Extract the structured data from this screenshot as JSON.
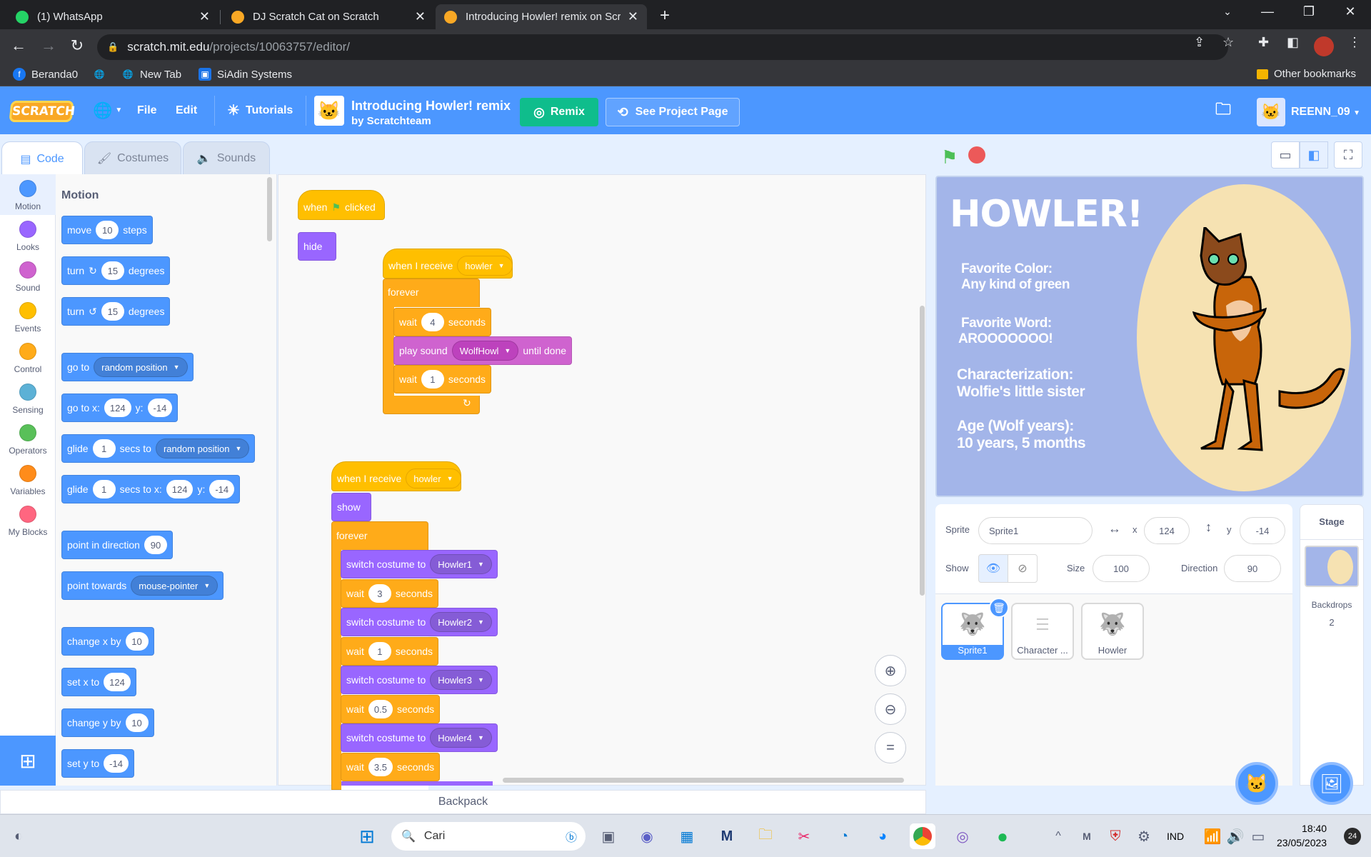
{
  "browser": {
    "tabs": [
      {
        "title": "(1) WhatsApp",
        "favicon_color": "#25d366",
        "active": false
      },
      {
        "title": "DJ Scratch Cat on Scratch",
        "favicon_color": "#f9a825",
        "active": false
      },
      {
        "title": "Introducing Howler! remix on Scr",
        "favicon_color": "#f9a825",
        "active": true
      }
    ],
    "url_host": "scratch.mit.edu",
    "url_path": "/projects/10063757/editor/",
    "bookmarks": [
      "Beranda0",
      "New Tab",
      "SiAdin Systems"
    ],
    "other_bookmarks": "Other bookmarks"
  },
  "menubar": {
    "logo": "SCRATCH",
    "file": "File",
    "edit": "Edit",
    "tutorials": "Tutorials",
    "project_title": "Introducing Howler! remix",
    "project_author": "by Scratchteam",
    "remix": "Remix",
    "see_project_page": "See Project Page",
    "username": "REENN_09"
  },
  "editor_tabs": [
    "Code",
    "Costumes",
    "Sounds"
  ],
  "categories": [
    {
      "label": "Motion",
      "color": "#4c97ff"
    },
    {
      "label": "Looks",
      "color": "#9966ff"
    },
    {
      "label": "Sound",
      "color": "#cf63cf"
    },
    {
      "label": "Events",
      "color": "#ffbf00"
    },
    {
      "label": "Control",
      "color": "#ffab19"
    },
    {
      "label": "Sensing",
      "color": "#5cb1d6"
    },
    {
      "label": "Operators",
      "color": "#59c059"
    },
    {
      "label": "Variables",
      "color": "#ff8c1a"
    },
    {
      "label": "My Blocks",
      "color": "#ff6680"
    }
  ],
  "palette": {
    "title": "Motion",
    "move": {
      "pre": "move",
      "val": "10",
      "post": "steps"
    },
    "turn_right": {
      "pre": "turn",
      "val": "15",
      "post": "degrees"
    },
    "turn_left": {
      "pre": "turn",
      "val": "15",
      "post": "degrees"
    },
    "goto": {
      "pre": "go to",
      "dd": "random position"
    },
    "gotoxy": {
      "pre": "go to x:",
      "x": "124",
      "ylbl": "y:",
      "y": "-14"
    },
    "glide_to": {
      "pre": "glide",
      "val": "1",
      "mid": "secs to",
      "dd": "random position"
    },
    "glide_xy": {
      "pre": "glide",
      "val": "1",
      "mid": "secs to x:",
      "x": "124",
      "ylbl": "y:",
      "y": "-14"
    },
    "point_dir": {
      "pre": "point in direction",
      "val": "90"
    },
    "point_towards": {
      "pre": "point towards",
      "dd": "mouse-pointer"
    },
    "change_x": {
      "pre": "change x by",
      "val": "10"
    },
    "set_x": {
      "pre": "set x to",
      "val": "124"
    },
    "change_y": {
      "pre": "change y by",
      "val": "10"
    },
    "set_y": {
      "pre": "set y to",
      "val": "-14"
    }
  },
  "scripts": {
    "s1": {
      "when": "when",
      "clicked": "clicked",
      "hide": "hide"
    },
    "s2": {
      "hat": "when I receive",
      "hat_dd": "howler",
      "forever": "forever",
      "wait1_pre": "wait",
      "wait1_val": "4",
      "wait1_post": "seconds",
      "play_pre": "play sound",
      "play_dd": "WolfHowl",
      "play_post": "until done",
      "wait2_pre": "wait",
      "wait2_val": "1",
      "wait2_post": "seconds"
    },
    "s3": {
      "hat": "when I receive",
      "hat_dd": "howler",
      "show": "show",
      "forever": "forever",
      "sc1": "switch costume to",
      "sc1_dd": "Howler1",
      "w1": "wait",
      "w1_val": "3",
      "w1_post": "seconds",
      "sc2": "switch costume to",
      "sc2_dd": "Howler2",
      "w2": "wait",
      "w2_val": "1",
      "w2_post": "seconds",
      "sc3": "switch costume to",
      "sc3_dd": "Howler3",
      "w3": "wait",
      "w3_val": "0.5",
      "w3_post": "seconds",
      "sc4": "switch costume to",
      "sc4_dd": "Howler4",
      "w4": "wait",
      "w4_val": "3.5",
      "w4_post": "seconds"
    }
  },
  "backpack": "Backpack",
  "stage": {
    "title": "HOWLER!",
    "lines": [
      "Favorite Color:",
      "Any kind of green",
      "Favorite Word:",
      "AROOOOOOO!",
      "Characterization:",
      "Wolfie's little sister",
      "Age (Wolf years):",
      "10 years, 5 months"
    ]
  },
  "sprite_info": {
    "sprite_label": "Sprite",
    "sprite_name": "Sprite1",
    "x_label": "x",
    "x": "124",
    "y_label": "y",
    "y": "-14",
    "show_label": "Show",
    "size_label": "Size",
    "size": "100",
    "direction_label": "Direction",
    "direction": "90"
  },
  "sprites": [
    "Sprite1",
    "Character ...",
    "Howler"
  ],
  "stage_pane": {
    "title": "Stage",
    "backdrops_label": "Backdrops",
    "backdrops_count": "2"
  },
  "taskbar": {
    "search": "Cari",
    "lang": "IND",
    "time": "18:40",
    "date": "23/05/2023",
    "notif": "24"
  }
}
